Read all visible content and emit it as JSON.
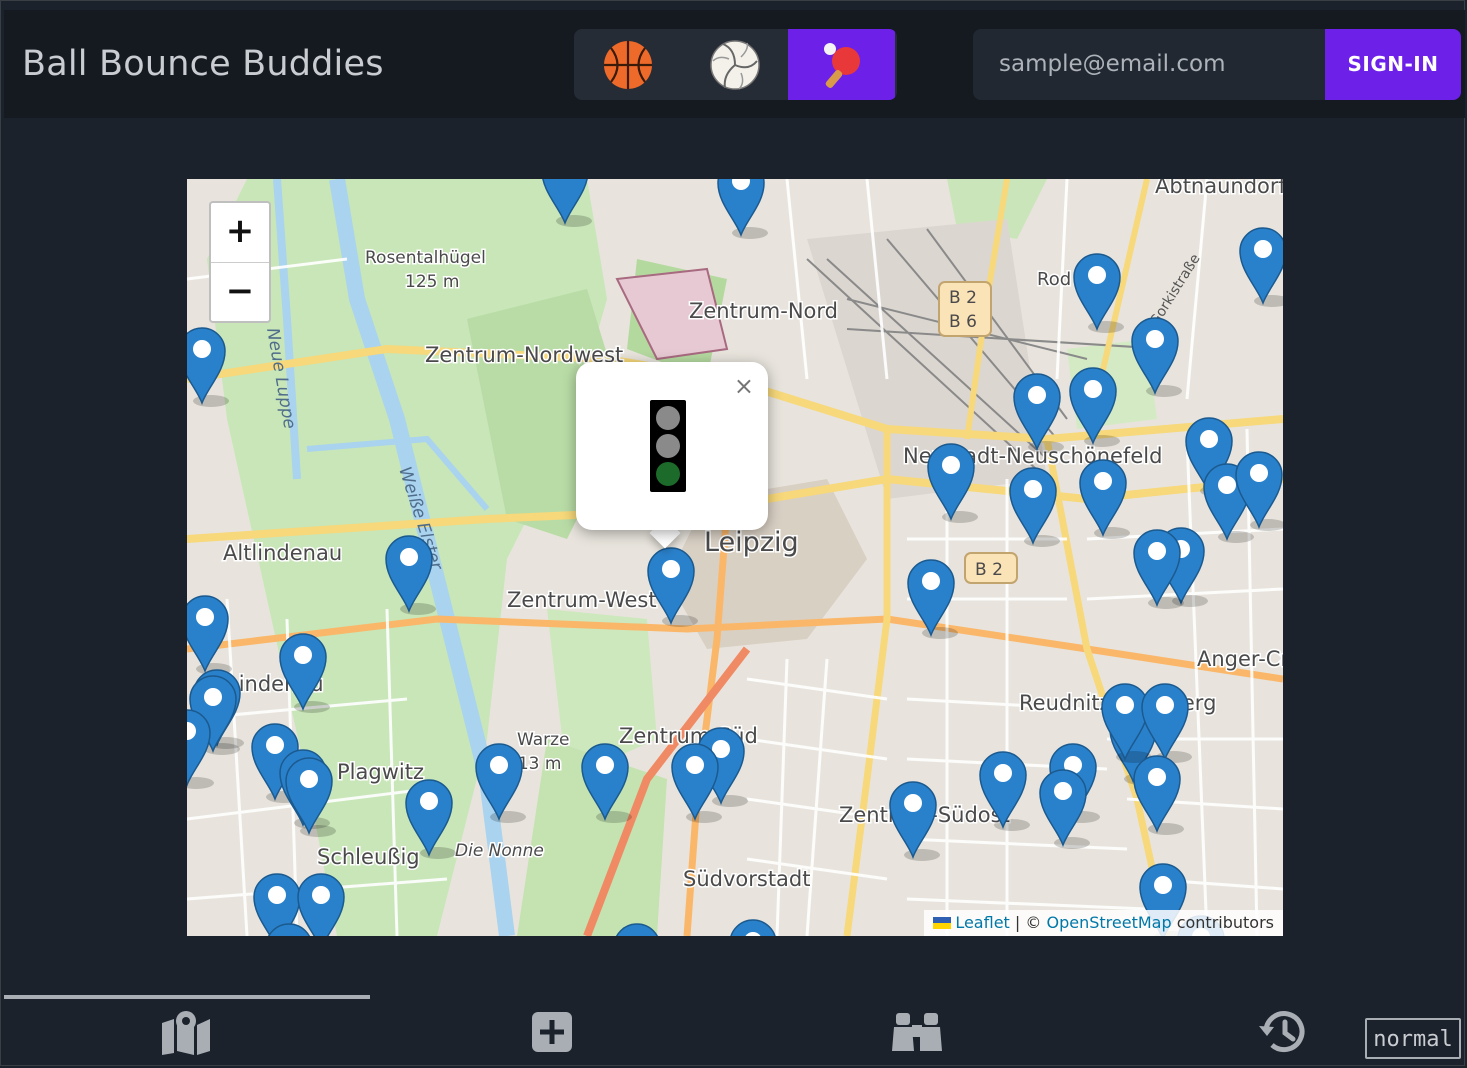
{
  "header": {
    "title": "Ball Bounce Buddies",
    "sports": [
      {
        "name": "basketball",
        "active": false
      },
      {
        "name": "volleyball",
        "active": false
      },
      {
        "name": "table-tennis",
        "active": true
      }
    ],
    "email_placeholder": "sample@email.com",
    "signin_label": "SIGN-IN"
  },
  "map": {
    "zoom_in": "+",
    "zoom_out": "−",
    "labels": {
      "rosental": "Rosentalhügel",
      "rosental_height": "125 m",
      "zentrum_nord": "Zentrum-Nord",
      "zentrum_nordwest": "Zentrum-Nordwest",
      "altlindenau": "Altlindenau",
      "zentrum_west": "Zentrum-West",
      "leipzig": "Leipzig",
      "zentrum_sud": "Zentrum-Süd",
      "zentrum_sudost": "Zentrum-Südost",
      "sudvorstadt": "Südvorstadt",
      "schleussig": "Schleußig",
      "neustadt": "Neustadt-Neuschönefeld",
      "reudnitz": "Reudnitz-Thonberg",
      "anger": "Anger-Cr",
      "abtnaundorf": "Abtnaundorf",
      "b2_1": "B 2",
      "b6": "B 6",
      "b2_2": "B 2",
      "die_nonne": "Die Nonne",
      "weisse_elster": "Weiße Elster",
      "luppe": "Neue Luppe",
      "gorkistrasse": "Gorkistraße",
      "warze": "Warze",
      "warze_height": "113 m",
      "lindenau": "Lindenau",
      "plagwitz": "Plagwitz",
      "rod": "Rod"
    },
    "popup_close": "×",
    "popup_signal": {
      "red": "#8a8a8a",
      "yellow": "#8a8a8a",
      "green": "#1d6b2a"
    },
    "attribution": {
      "leaflet": "Leaflet",
      "sep": "| ©",
      "osm": "OpenStreetMap",
      "contributors": "contributors"
    }
  },
  "nav": {
    "items": [
      "map-icon",
      "add-icon",
      "binoculars-icon",
      "history-icon"
    ],
    "active_index": 0,
    "mode_label": "normal"
  },
  "colors": {
    "accent": "#6c20e8",
    "marker": "#2a81cb",
    "background": "#1c222b"
  }
}
